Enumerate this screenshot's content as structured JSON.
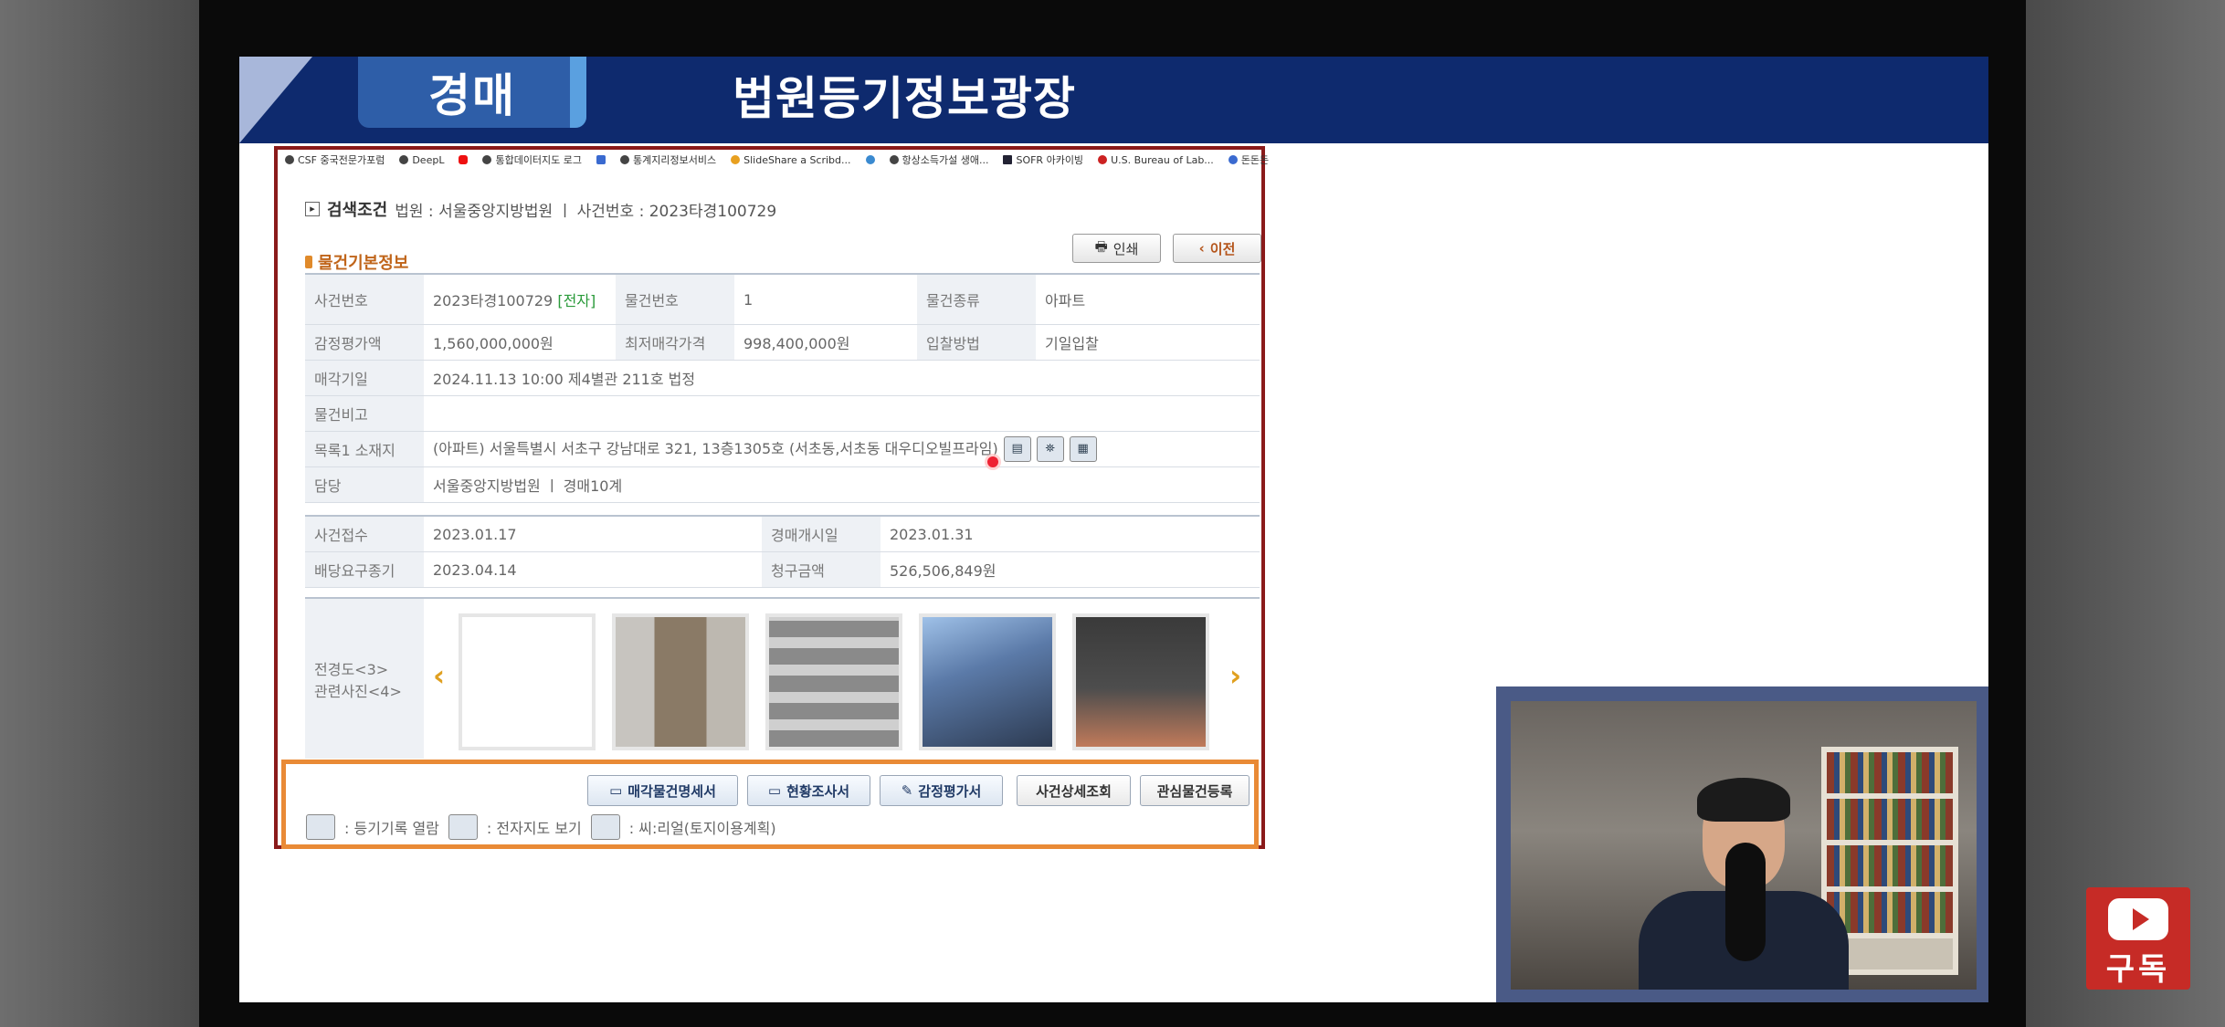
{
  "banner": {
    "tab": "경매",
    "title": "법원등기정보광장"
  },
  "bookmarks": [
    "CSF 중국전문가포럼",
    "DeepL",
    "통합데이터지도 로그",
    "통계지리정보서비스",
    "SlideShare a Scribd...",
    "항상소득가설 생애...",
    "SOFR 아카이빙",
    "U.S. Bureau of Lab...",
    "돈돈돈"
  ],
  "search": {
    "label": "검색조건",
    "text": "법원 : 서울중앙지방법원 ㅣ 사건번호 : 2023타경100729"
  },
  "buttons": {
    "print": "인쇄",
    "prev": "이전"
  },
  "section": {
    "title": "물건기본정보"
  },
  "info": {
    "case_no_label": "사건번호",
    "case_no": "2023타경100729",
    "case_no_tag": "[전자]",
    "item_no_label": "물건번호",
    "item_no": "1",
    "item_type_label": "물건종류",
    "item_type": "아파트",
    "appraisal_label": "감정평가액",
    "appraisal": "1,560,000,000원",
    "min_price_label": "최저매각가격",
    "min_price": "998,400,000원",
    "bid_method_label": "입찰방법",
    "bid_method": "기일입찰",
    "sale_date_label": "매각기일",
    "sale_date": "2024.11.13 10:00 제4별관 211호 법정",
    "note_label": "물건비고",
    "note": "",
    "location_label": "목록1 소재지",
    "location": "(아파트) 서울특별시 서초구 강남대로 321, 13층1305호 (서초동,서초동 대우디오빌프라임)",
    "dept_label": "담당",
    "dept": "서울중앙지방법원 ㅣ 경매10계"
  },
  "dates": {
    "received_label": "사건접수",
    "received": "2023.01.17",
    "start_label": "경매개시일",
    "start": "2023.01.31",
    "deadline_label": "배당요구종기",
    "deadline": "2023.04.14",
    "claim_label": "청구금액",
    "claim": "526,506,849원"
  },
  "gallery": {
    "label_1": "전경도<3>",
    "label_2": "관련사진<4>",
    "photo_count": 5
  },
  "bottom": {
    "btn1": "매각물건명세서",
    "btn2": "현황조사서",
    "btn3": "감정평가서",
    "btn4": "사건상세조회",
    "btn5": "관심물건등록",
    "legend1": ": 등기기록 열람",
    "legend2": ": 전자지도 보기",
    "legend3": ": 씨:리얼(토지이용계획)"
  },
  "subscribe": {
    "label": "구독"
  }
}
